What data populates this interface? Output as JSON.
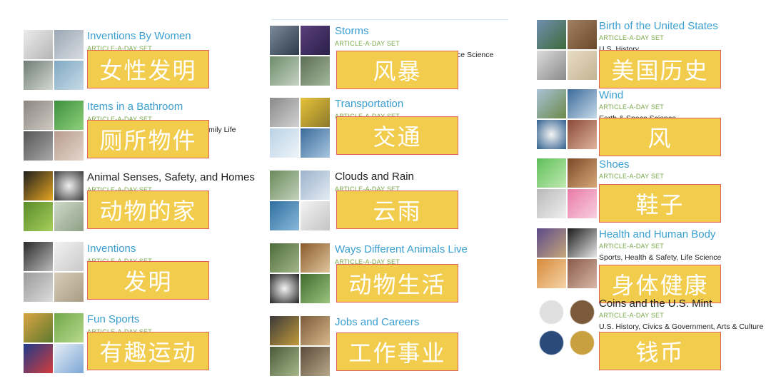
{
  "items": [
    {
      "key": "inventions-by-women",
      "title": "Inventions By Women",
      "subtitle": "ARTICLE-A-DAY SET",
      "category": "",
      "overlay": "女性发明"
    },
    {
      "key": "items-in-a-bathroom",
      "title": "Items in a Bathroom",
      "subtitle": "ARTICLE-A-DAY SET",
      "category": "mily Life",
      "overlay": "厕所物件"
    },
    {
      "key": "animal-senses",
      "title": "Animal Senses, Safety, and Homes",
      "subtitle": "ARTICLE-A-DAY SET",
      "category": "",
      "overlay": "动物的家"
    },
    {
      "key": "inventions",
      "title": "Inventions",
      "subtitle": "ARTICLE-A-DAY SET",
      "category": "",
      "overlay": "发明"
    },
    {
      "key": "fun-sports",
      "title": "Fun Sports",
      "subtitle": "ARTICLE-A-DAY SET",
      "category": "",
      "overlay": "有趣运动"
    },
    {
      "key": "storms",
      "title": "Storms",
      "subtitle": "ARTICLE-A-DAY SET",
      "category": "ce Science",
      "overlay": "风暴"
    },
    {
      "key": "transportation",
      "title": "Transportation",
      "subtitle": "ARTICLE-A-DAY SET",
      "category": "",
      "overlay": "交通"
    },
    {
      "key": "clouds-and-rain",
      "title": "Clouds and Rain",
      "subtitle": "ARTICLE-A-DAY SET",
      "category": "",
      "overlay": "云雨"
    },
    {
      "key": "ways-animals-live",
      "title": "Ways Different Animals Live",
      "subtitle": "ARTICLE-A-DAY SET",
      "category": "",
      "overlay": "动物生活"
    },
    {
      "key": "jobs-and-careers",
      "title": "Jobs and Careers",
      "subtitle": "",
      "category": "",
      "overlay": "工作事业"
    },
    {
      "key": "birth-of-us",
      "title": "Birth of the United States",
      "subtitle": "ARTICLE-A-DAY SET",
      "category": "U.S. History",
      "overlay": "美国历史"
    },
    {
      "key": "wind",
      "title": "Wind",
      "subtitle": "ARTICLE-A-DAY SET",
      "category": "Earth & Space Science",
      "overlay": "风"
    },
    {
      "key": "shoes",
      "title": "Shoes",
      "subtitle": "ARTICLE-A-DAY SET",
      "category": "",
      "overlay": "鞋子"
    },
    {
      "key": "health-human-body",
      "title": "Health and Human Body",
      "subtitle": "ARTICLE-A-DAY SET",
      "category": "Sports, Health & Safety, Life Science",
      "overlay": "身体健康"
    },
    {
      "key": "coins-us-mint",
      "title": "Coins and the U.S. Mint",
      "subtitle": "ARTICLE-A-DAY SET",
      "category": "U.S. History, Civics & Government, Arts & Culture",
      "overlay": "钱币"
    }
  ],
  "colors": {
    "link": "#3a9fd0",
    "subtitle": "#79a84a",
    "overlay_fill": "#f2cc4c",
    "overlay_border": "#e0605a"
  }
}
